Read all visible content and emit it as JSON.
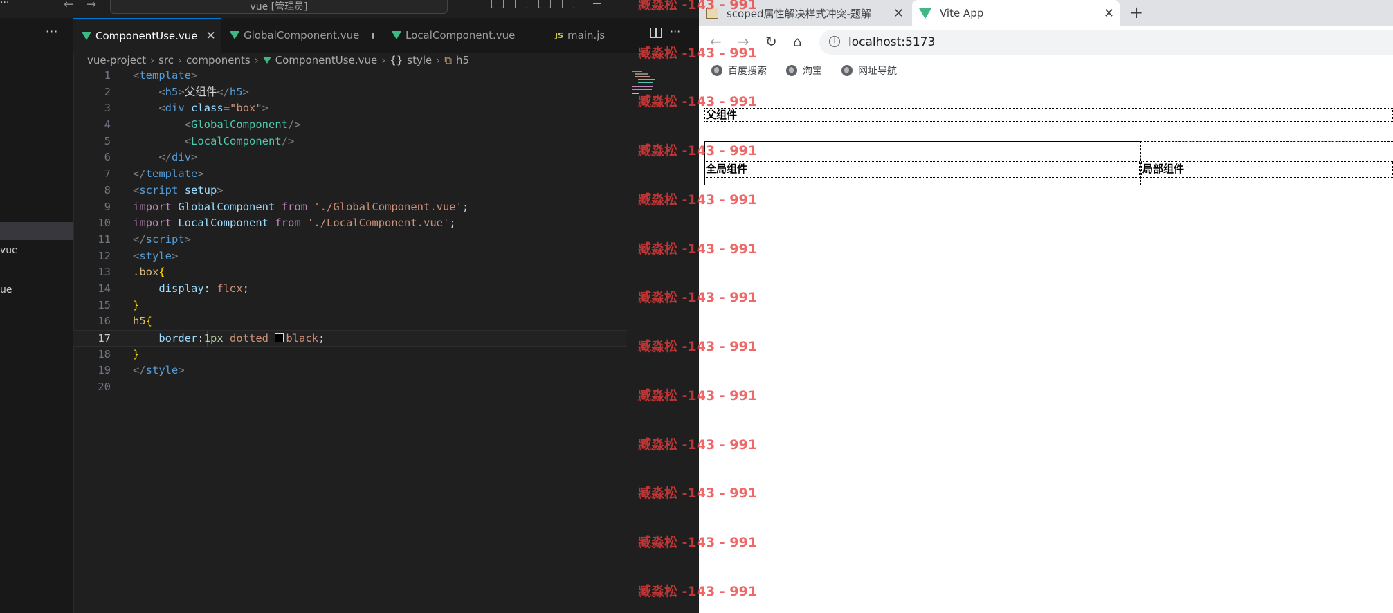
{
  "vscode": {
    "search_placeholder": "vue [管理员]",
    "tabs": [
      {
        "label": "ComponentUse.vue",
        "icon": "vue-icon",
        "active": true
      },
      {
        "label": "GlobalComponent.vue",
        "icon": "vue-icon",
        "modified": true
      },
      {
        "label": "LocalComponent.vue",
        "icon": "vue-icon"
      },
      {
        "label": "main.js",
        "icon": "js-icon"
      }
    ],
    "js_badge": "JS",
    "sidebar_fragments": [
      "vue",
      "ue"
    ],
    "breadcrumb": [
      "vue-project",
      "src",
      "components",
      "ComponentUse.vue",
      "style",
      "h5"
    ],
    "breadcrumb_symbols": {
      "braces": "{}",
      "tag": "⧉"
    },
    "line_numbers": [
      "1",
      "2",
      "3",
      "4",
      "5",
      "6",
      "7",
      "8",
      "9",
      "10",
      "11",
      "12",
      "13",
      "14",
      "15",
      "16",
      "17",
      "18",
      "19",
      "20"
    ],
    "current_line": 17,
    "code": {
      "l1_open": "<",
      "l1_tag": "template",
      "l1_close": ">",
      "l2_open": "<",
      "l2_tag": "h5",
      "l2_close": ">",
      "l2_text": "父组件",
      "l2_end_open": "</",
      "l2_end_tag": "h5",
      "l2_end_close": ">",
      "l3_open": "<",
      "l3_tag": "div",
      "l3_attr": "class",
      "l3_eq": "=",
      "l3_str": "\"box\"",
      "l3_close": ">",
      "l4_open": "<",
      "l4_tag": "GlobalComponent",
      "l4_close": "/>",
      "l5_open": "<",
      "l5_tag": "LocalComponent",
      "l5_close": "/>",
      "l6_open": "</",
      "l6_tag": "div",
      "l6_close": ">",
      "l7_open": "</",
      "l7_tag": "template",
      "l7_close": ">",
      "l8_open": "<",
      "l8_tag": "script",
      "l8_attr": "setup",
      "l8_close": ">",
      "l9_kw1": "import",
      "l9_id": "GlobalComponent",
      "l9_kw2": "from",
      "l9_str": "'./GlobalComponent.vue'",
      "l9_semi": ";",
      "l10_kw1": "import",
      "l10_id": "LocalComponent",
      "l10_kw2": "from",
      "l10_str": "'./LocalComponent.vue'",
      "l10_semi": ";",
      "l11_open": "</",
      "l11_tag": "script",
      "l11_close": ">",
      "l12_open": "<",
      "l12_tag": "style",
      "l12_close": ">",
      "l13_sel": ".box",
      "l13_brace": "{",
      "l14_prop": "display",
      "l14_colon": ": ",
      "l14_val": "flex",
      "l14_semi": ";",
      "l15_brace": "}",
      "l16_sel": "h5",
      "l16_brace": "{",
      "l17_prop": "border",
      "l17_colon": ":",
      "l17_num": "1px",
      "l17_val1": "dotted",
      "l17_val2": "black",
      "l17_semi": ";",
      "l18_brace": "}",
      "l19_open": "</",
      "l19_tag": "style",
      "l19_close": ">"
    }
  },
  "browser": {
    "tabs": [
      {
        "label": "scoped属性解决样式冲突-题解",
        "active": false
      },
      {
        "label": "Vite App",
        "active": true
      }
    ],
    "close_glyph": "✕",
    "new_tab_glyph": "+",
    "url": "localhost:5173",
    "bookmarks": [
      "百度搜索",
      "淘宝",
      "网址导航"
    ],
    "page": {
      "parent_heading": "父组件",
      "global_heading": "全局组件",
      "local_heading": "局部组件"
    }
  },
  "watermark": {
    "text": "臧淼松 -143 - 991",
    "color": "#eb3c3c"
  },
  "colors": {
    "accent": "#0078d4",
    "vue_green": "#41b883"
  }
}
